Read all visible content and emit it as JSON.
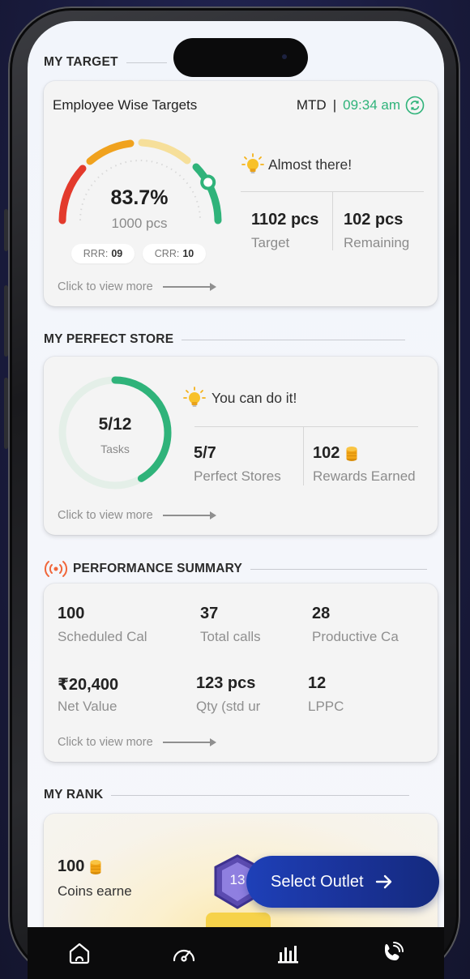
{
  "sections": {
    "target": "MY TARGET",
    "perfect_store": "MY PERFECT STORE",
    "performance": "PERFORMANCE SUMMARY",
    "rank": "MY RANK"
  },
  "target_card": {
    "title": "Employee Wise Targets",
    "period": "MTD",
    "separator": "|",
    "time": "09:34 am",
    "percent": "83.7%",
    "achieved": "1000 pcs",
    "progress": 0.837,
    "rrr_label": "RRR:",
    "rrr_value": "09",
    "crr_label": "CRR:",
    "crr_value": "10",
    "message": "Almost there!",
    "target_value": "1102 pcs",
    "target_label": "Target",
    "remaining_value": "102 pcs",
    "remaining_label": "Remaining",
    "more": "Click to view more"
  },
  "perfect_store_card": {
    "fraction": "5/12",
    "tasks_label": "Tasks",
    "progress": 0.4167,
    "message": "You can do it!",
    "stores_value": "5/7",
    "stores_label": "Perfect Stores",
    "rewards_value": "102",
    "rewards_label": "Rewards Earned",
    "more": "Click to view more"
  },
  "performance_card": {
    "items": [
      {
        "value": "100",
        "label": "Scheduled Cal"
      },
      {
        "value": "37",
        "label": "Total calls"
      },
      {
        "value": "28",
        "label": "Productive Ca"
      },
      {
        "value": "₹20,400",
        "label": "Net Value"
      },
      {
        "value": "123 pcs",
        "label": "Qty (std ur"
      },
      {
        "value": "12",
        "label": "LPPC"
      }
    ],
    "more": "Click to view more"
  },
  "rank_card": {
    "coins_value": "100",
    "coins_label": "Coins earne",
    "rank_badge": "13"
  },
  "fab": {
    "label": "Select Outlet"
  },
  "nav": [
    "home-icon",
    "speedometer-icon",
    "bar-chart-icon",
    "phone-call-icon"
  ],
  "colors": {
    "accent_green": "#2fb37a",
    "gauge_red": "#e33a2c",
    "gauge_orange": "#f0a21e",
    "gauge_yellow": "#f6df9a",
    "fab_blue": "#1b3aa8",
    "coin": "#f2a516"
  }
}
